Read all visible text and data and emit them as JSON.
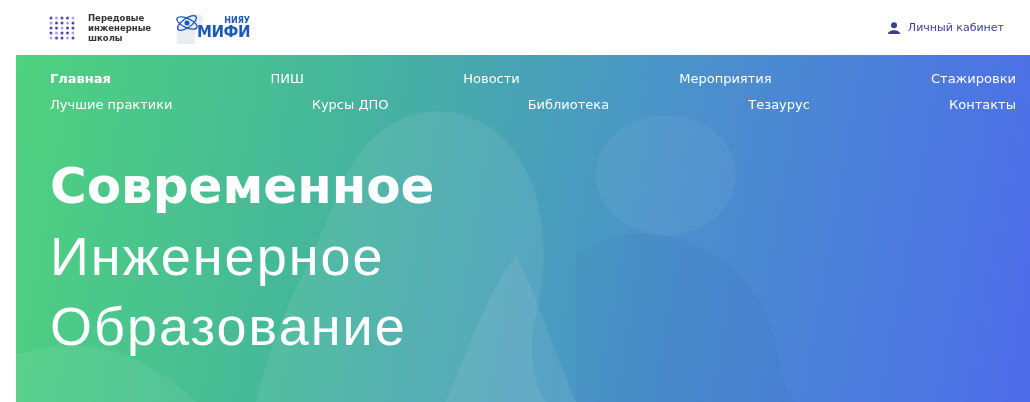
{
  "header": {
    "brand_lines": [
      "Передовые",
      "инженерные",
      "школы"
    ],
    "partner_logo": {
      "caption": "НИЯУ",
      "name": "МИФИ"
    },
    "account_link": "Личный кабинет"
  },
  "nav": [
    {
      "label": "Главная",
      "selected": true
    },
    {
      "label": "ПИШ",
      "selected": false
    },
    {
      "label": "Новости",
      "selected": false
    },
    {
      "label": "Мероприятия",
      "selected": false
    },
    {
      "label": "Стажировки",
      "selected": false
    },
    {
      "label": "Лучшие практики",
      "selected": false
    },
    {
      "label": "Курсы ДПО",
      "selected": false
    },
    {
      "label": "Библиотека",
      "selected": false
    },
    {
      "label": "Тезаурус",
      "selected": false
    },
    {
      "label": "Контакты",
      "selected": false
    }
  ],
  "hero": {
    "kind": "picture",
    "title_lines": [
      {
        "text": "Современное",
        "kind": "bold"
      },
      {
        "text": "Инженерное",
        "kind": "light"
      },
      {
        "text": "Образование",
        "kind": "light"
      }
    ]
  }
}
